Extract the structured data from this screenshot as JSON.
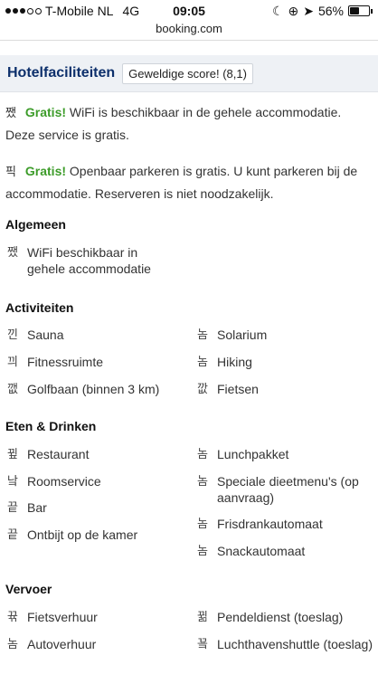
{
  "status": {
    "carrier": "T-Mobile NL",
    "network": "4G",
    "time": "09:05",
    "battery": "56%",
    "battery_level": 0.56
  },
  "url": "booking.com",
  "header": {
    "title": "Hotelfaciliteiten",
    "score": "Geweldige score! (8,1)"
  },
  "free": [
    {
      "icon": "wifi-icon",
      "gratis": "Gratis!",
      "text": "WiFi is beschikbaar in de gehele accommodatie. Deze service is gratis."
    },
    {
      "icon": "parking-icon",
      "gratis": "Gratis!",
      "text": "Openbaar parkeren is gratis. U kunt parkeren bij de accommodatie. Reserveren is niet noodzakelijk."
    }
  ],
  "sections": {
    "algemeen": {
      "title": "Algemeen",
      "items": [
        "WiFi beschikbaar in gehele accommodatie"
      ]
    },
    "activiteiten": {
      "title": "Activiteiten",
      "left": [
        "Sauna",
        "Fitnessruimte",
        "Golfbaan (binnen 3 km)"
      ],
      "right": [
        "Solarium",
        "Hiking",
        "Fietsen"
      ]
    },
    "eten": {
      "title": "Eten & Drinken",
      "left": [
        "Restaurant",
        "Roomservice",
        "Bar",
        "Ontbijt op de kamer"
      ],
      "right": [
        "Lunchpakket",
        "Speciale dieetmenu's (op aanvraag)",
        "Frisdrankautomaat",
        "Snackautomaat"
      ]
    },
    "vervoer": {
      "title": "Vervoer",
      "left": [
        "Fietsverhuur",
        "Autoverhuur"
      ],
      "right": [
        "Pendeldienst (toeslag)",
        "Luchthavenshuttle (toeslag)"
      ]
    }
  },
  "glyphs": {
    "wifi": "쨌",
    "parking": "픽",
    "sauna": "낀",
    "fitness": "끠",
    "golf": "깺",
    "solarium": "놈",
    "hiking": "놈",
    "cycling": "깞",
    "restaurant": "뀦",
    "roomservice": "낰",
    "bar": "끝",
    "breakfast": "끝",
    "lunch": "놈",
    "diet": "놈",
    "soda": "놈",
    "snack": "놈",
    "bike": "뀪",
    "car": "놈",
    "shuttle": "뀖",
    "airport": "꾴"
  }
}
